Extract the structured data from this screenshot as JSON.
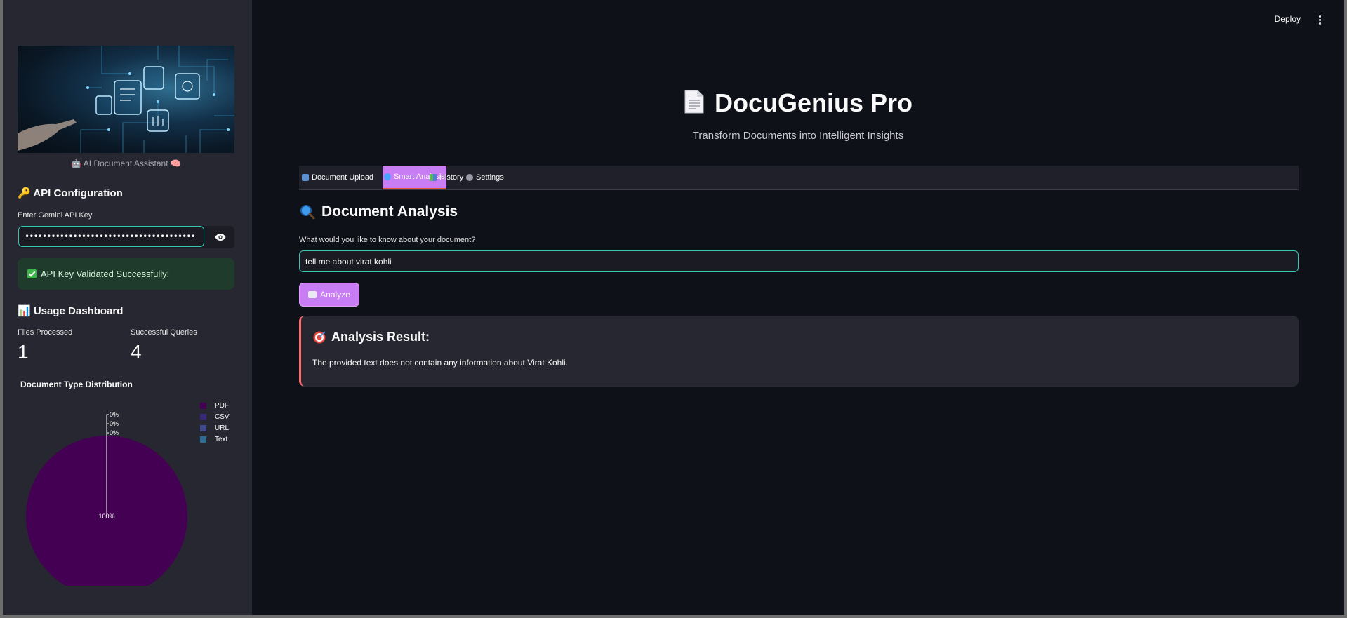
{
  "sidebar": {
    "caption": "🤖 AI Document Assistant 🧠",
    "api_heading": "🔑 API Configuration",
    "api_key_label": "Enter Gemini API Key",
    "api_key_value": "•••••••••••••••••••••••••••••••••••••••",
    "success_text": "API Key Validated Successfully!",
    "usage_heading": "📊 Usage Dashboard",
    "metrics": [
      {
        "label": "Files Processed",
        "value": "1"
      },
      {
        "label": "Successful Queries",
        "value": "4"
      }
    ],
    "pie_title": "Document Type Distribution",
    "chart_data": {
      "type": "pie",
      "title": "Document Type Distribution",
      "labels": [
        "PDF",
        "CSV",
        "URL",
        "Text"
      ],
      "values": [
        100,
        0,
        0,
        0
      ],
      "slice_labels": [
        "100%",
        "0%",
        "0%",
        "0%"
      ],
      "colors": [
        "#440154",
        "#3b2a7b",
        "#40498c",
        "#2d6d94"
      ],
      "legend_position": "top-right"
    }
  },
  "header": {
    "deploy_label": "Deploy"
  },
  "main": {
    "title": "DocuGenius Pro",
    "subtitle": "Transform Documents into Intelligent Insights",
    "tabs": [
      {
        "label": "Document Upload"
      },
      {
        "label": "Smart Analysis",
        "active": true
      },
      {
        "label": "History"
      },
      {
        "label": "Settings"
      }
    ],
    "section_title": "Document Analysis",
    "question_label": "What would you like to know about your document?",
    "question_value": "tell me about virat kohli",
    "analyze_label": "Analyze",
    "result_title": "Analysis Result:",
    "result_text": "The provided text does not contain any information about Virat Kohli."
  },
  "colors": {
    "accent": "#c97df5",
    "input_focus": "#38c7b5",
    "success_bg": "#1e3b2b",
    "result_border": "#ff6b6b"
  }
}
